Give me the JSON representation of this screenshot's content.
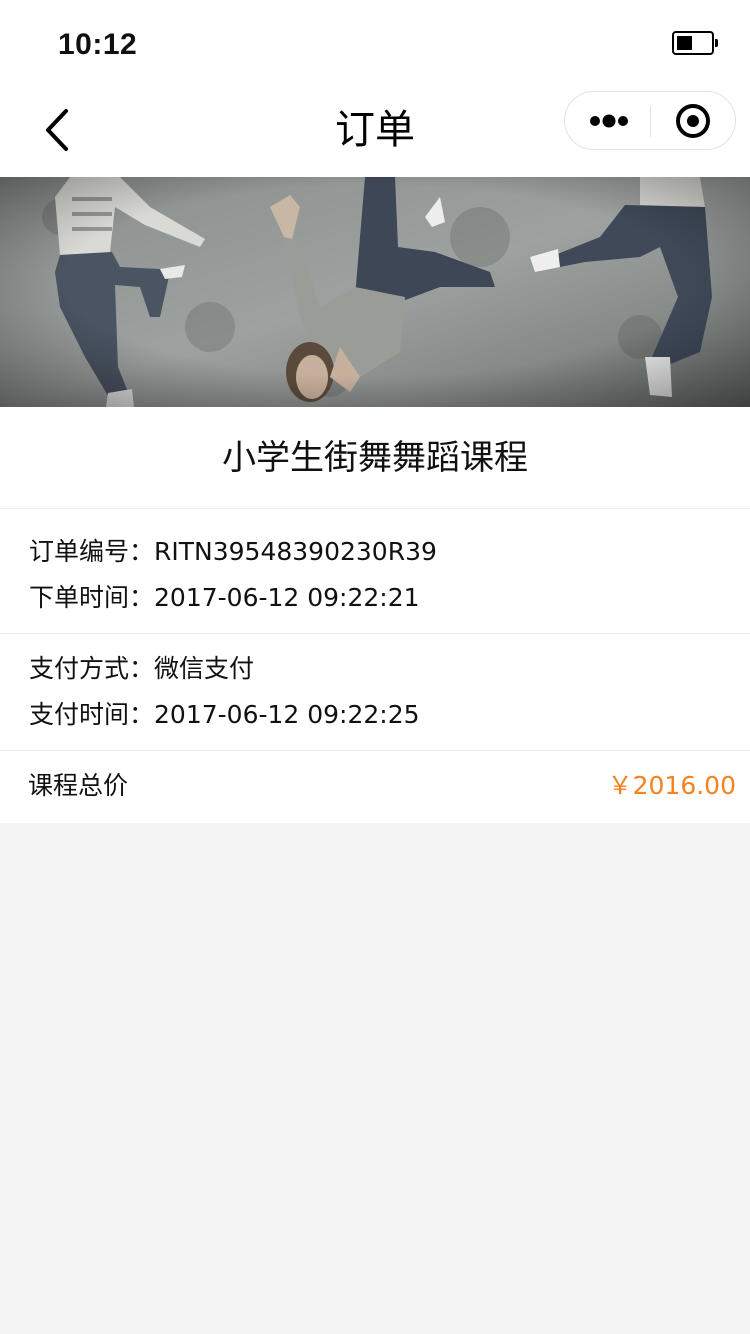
{
  "status_bar": {
    "time": "10:12",
    "battery_level": 0.45
  },
  "nav": {
    "title": "订单"
  },
  "banner": {
    "image": "street-dance-photo"
  },
  "course": {
    "title": "小学生街舞舞蹈课程"
  },
  "order_info": {
    "order_no_label": "订单编号：",
    "order_no_value": "RITN39548390230R39",
    "order_time_label": "下单时间：",
    "order_time_value": "2017-06-12 09:22:21"
  },
  "payment_info": {
    "method_label": "支付方式：",
    "method_value": "微信支付",
    "pay_time_label": "支付时间：",
    "pay_time_value": "2017-06-12 09:22:25"
  },
  "price": {
    "label": "课程总价",
    "value": "￥2016.00"
  },
  "colors": {
    "accent_price": "#f5821f",
    "page_background": "#f4f4f4",
    "card_background": "#ffffff"
  },
  "icons": [
    "back-arrow-icon",
    "more-dots-icon",
    "target-close-icon",
    "battery-icon"
  ]
}
